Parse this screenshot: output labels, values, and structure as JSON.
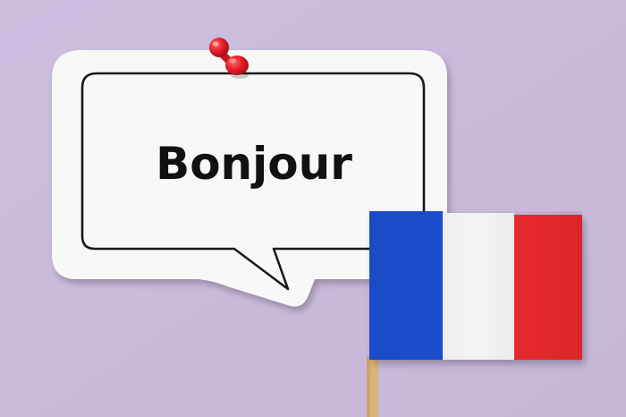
{
  "scene": {
    "description_colors": {
      "background": "#cbbcdc",
      "card": "#f7f7f7",
      "card_outline": "#1a1a1a",
      "pin": "#e8202a",
      "flag_blue": "#1f4fd0",
      "flag_white": "#f4f4f4",
      "flag_red": "#ee2b2f",
      "flag_stick": "#d9b77e"
    },
    "speech_bubble": {
      "text": "Bonjour"
    },
    "pin": {
      "icon": "push-pin-icon"
    },
    "flag": {
      "icon": "france-flag-icon"
    }
  }
}
